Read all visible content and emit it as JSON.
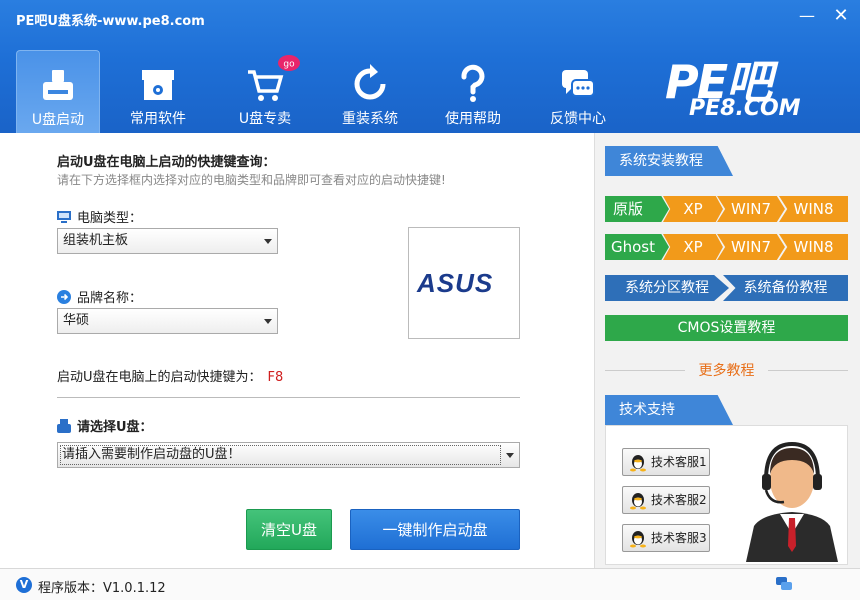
{
  "window": {
    "title": "PE吧U盘系统-www.pe8.com",
    "min_label": "—",
    "close_label": "✕"
  },
  "nav": [
    {
      "label": "U盘启动",
      "icon": "usb-drive-icon",
      "active": true
    },
    {
      "label": "常用软件",
      "icon": "software-box-icon",
      "active": false
    },
    {
      "label": "U盘专卖",
      "icon": "shopping-cart-icon",
      "active": false,
      "badge": "go"
    },
    {
      "label": "重装系统",
      "icon": "refresh-icon",
      "active": false
    },
    {
      "label": "使用帮助",
      "icon": "question-icon",
      "active": false
    },
    {
      "label": "反馈中心",
      "icon": "chat-bubble-icon",
      "active": false
    }
  ],
  "logo": {
    "main": "PE吧",
    "url": "PE8.COM"
  },
  "query": {
    "title": "启动U盘在电脑上启动的快捷键查询：",
    "subtitle": "请在下方选择框内选择对应的电脑类型和品牌即可查看对应的启动快捷键!",
    "pc_type_label": "电脑类型：",
    "pc_type_value": "组装机主板",
    "brand_label": "品牌名称：",
    "brand_value": "华硕",
    "brand_logo_text": "ASUS",
    "hotkey_label": "启动U盘在电脑上的启动快捷键为：",
    "hotkey_value": "F8"
  },
  "udisk": {
    "label": "请选择U盘：",
    "value": "请插入需要制作启动盘的U盘！"
  },
  "buttons": {
    "clear": "清空U盘",
    "make": "一键制作启动盘"
  },
  "right": {
    "install_tab": "系统安装教程",
    "original_label": "原版",
    "ghost_label": "Ghost",
    "xp": "XP",
    "win7": "WIN7",
    "win8": "WIN8",
    "partition": "系统分区教程",
    "backup": "系统备份教程",
    "cmos": "CMOS设置教程",
    "more": "更多教程",
    "support_tab": "技术支持",
    "qq": [
      "技术客服1",
      "技术客服2",
      "技术客服3"
    ]
  },
  "status": {
    "version": "程序版本：V1.0.1.12"
  },
  "colors": {
    "header_blue": "#1e6fd6",
    "green": "#2ea84a",
    "orange": "#f29a1a",
    "dark_blue": "#2e6fb8",
    "hotkey_red": "#d02020",
    "more_orange": "#e8701a"
  }
}
